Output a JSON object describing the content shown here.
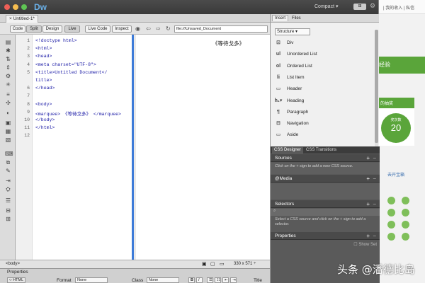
{
  "app": {
    "name": "Dw",
    "workspace": "Compact",
    "sync_label": "⊞"
  },
  "document_tab": "Untitled-1*",
  "toolbar": {
    "code": "Code",
    "split": "Split",
    "design": "Design",
    "live": "Live",
    "live_code": "Live Code",
    "inspect": "Inspect",
    "address": "file:///Unsaved_Document"
  },
  "code_lines": [
    {
      "n": "1",
      "html": "<!doctype html>"
    },
    {
      "n": "2",
      "html": "<html>"
    },
    {
      "n": "3",
      "html": "<head>"
    },
    {
      "n": "4",
      "html": "<meta charset=\"UTF-8\">"
    },
    {
      "n": "5",
      "html": "<title>Untitled Document</"
    },
    {
      "n": "",
      "html": "title>"
    },
    {
      "n": "6",
      "html": "</head>"
    },
    {
      "n": "7",
      "html": ""
    },
    {
      "n": "8",
      "html": "<body>"
    },
    {
      "n": "9",
      "html": " <marquee> 《等待戈多》 </marquee>"
    },
    {
      "n": "10",
      "html": "</body>"
    },
    {
      "n": "11",
      "html": "</html>"
    },
    {
      "n": "12",
      "html": ""
    }
  ],
  "design_preview": "《等待戈多》",
  "status": {
    "tag": "<body>",
    "size": "330 x 571 ÷"
  },
  "properties": {
    "title": "Properties",
    "html_btn": "HTML",
    "format_label": "Format",
    "format_value": "None",
    "class_label": "Class",
    "class_value": "None",
    "bold": "B",
    "italic": "I",
    "title_label": "Title"
  },
  "right_tabs": {
    "insert": "Insert",
    "files": "Files"
  },
  "insert_dropdown": "Structure",
  "insert_items": [
    {
      "icon": "div-icon",
      "glyph": "⊡",
      "label": "Div"
    },
    {
      "icon": "unordered-list-icon",
      "glyph": "ul",
      "label": "Unordered List"
    },
    {
      "icon": "ordered-list-icon",
      "glyph": "ol",
      "label": "Ordered List"
    },
    {
      "icon": "list-item-icon",
      "glyph": "li",
      "label": "List Item"
    },
    {
      "icon": "header-icon",
      "glyph": "▭",
      "label": "Header"
    },
    {
      "icon": "heading-icon",
      "glyph": "h₁▾",
      "label": "Heading"
    },
    {
      "icon": "paragraph-icon",
      "glyph": "¶",
      "label": "Paragraph"
    },
    {
      "icon": "navigation-icon",
      "glyph": "⊟",
      "label": "Navigation"
    },
    {
      "icon": "aside-icon",
      "glyph": "▭",
      "label": "Aside"
    }
  ],
  "css_tabs": {
    "designer": "CSS Designer",
    "transitions": "CSS Transitions"
  },
  "css_sections": {
    "sources": "Sources",
    "sources_hint": "Click on the + sign to add a new CSS source.",
    "media": "@Media",
    "selectors": "Selectors",
    "selectors_hint": "Select a CSS source and click on the + sign to add a selector.",
    "properties": "Properties",
    "show_set": "Show Set"
  },
  "background_page": {
    "top_text": "| 我的收入 | 私信",
    "banner": "经验",
    "card_title": "的抽奖",
    "card_sub": "奖次数",
    "card_count": "20",
    "side_link": "去开宝箱"
  },
  "watermark": "头条 @潘德比岛"
}
